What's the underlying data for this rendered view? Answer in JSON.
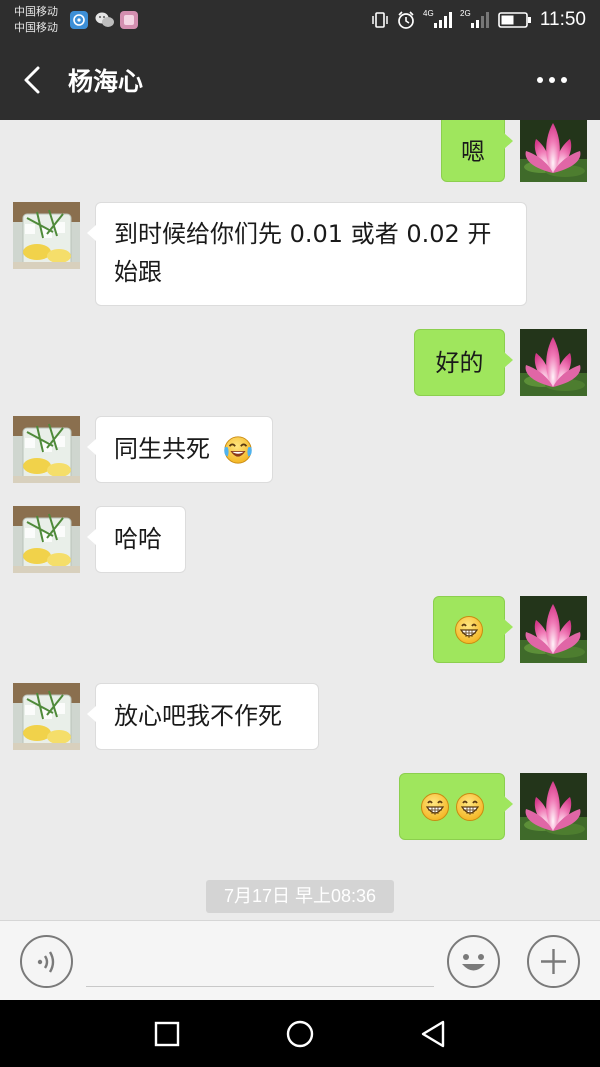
{
  "status_bar": {
    "carrier_1": "中国移动",
    "carrier_2": "中国移动",
    "net_1": "4G",
    "net_2": "2G",
    "time": "11:50",
    "icons": [
      "app-notification-icon",
      "wechat-notification-icon",
      "app-notification-icon",
      "vibrate-icon",
      "alarm-icon",
      "signal-icon",
      "battery-icon"
    ]
  },
  "header": {
    "title": "杨海心",
    "back_icon": "chevron-left-icon",
    "more_icon": "more-dots-icon"
  },
  "messages": [
    {
      "side": "out",
      "text": "嗯",
      "avatar": "lotus-avatar"
    },
    {
      "side": "in",
      "text": "到时候给你们先 0.01 或者 0.02 开始跟",
      "avatar": "drink-avatar"
    },
    {
      "side": "out",
      "text": "好的",
      "avatar": "lotus-avatar"
    },
    {
      "side": "in",
      "text": "同生共死",
      "emoji": "laugh-cry-emoji",
      "avatar": "drink-avatar"
    },
    {
      "side": "in",
      "text": "哈哈",
      "avatar": "drink-avatar"
    },
    {
      "side": "out",
      "text": "",
      "emoji": "grin-emoji",
      "avatar": "lotus-avatar"
    },
    {
      "side": "in",
      "text": "放心吧我不作死",
      "avatar": "drink-avatar"
    },
    {
      "side": "out",
      "text": "",
      "emoji": "grin-emoji x2",
      "avatar": "lotus-avatar"
    }
  ],
  "timestamp": "7月17日 早上08:36",
  "input_bar": {
    "voice_icon": "voice-icon",
    "emoji_icon": "smiley-icon",
    "plus_icon": "plus-icon",
    "placeholder": ""
  },
  "nav_bar": {
    "icons": [
      "recent-apps-icon",
      "home-icon",
      "back-icon"
    ]
  },
  "colors": {
    "header_bg": "#2e2e2e",
    "chat_bg": "#ebebeb",
    "out_bubble": "#9fe65d",
    "in_bubble": "#ffffff",
    "timestamp_bg": "#d4d4d4"
  }
}
